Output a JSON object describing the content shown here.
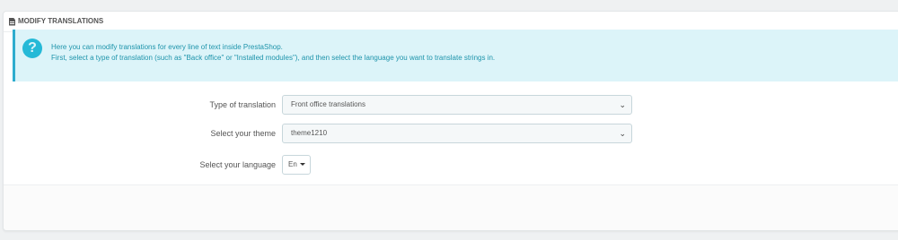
{
  "panel": {
    "title": "MODIFY TRANSLATIONS",
    "title_icon": "document-icon"
  },
  "alert": {
    "icon": "question-icon",
    "icon_glyph": "?",
    "line1": "Here you can modify translations for every line of text inside PrestaShop.",
    "line2": "First, select a type of translation (such as \"Back office\" or \"Installed modules\"), and then select the language you want to translate strings in."
  },
  "form": {
    "type_label": "Type of translation",
    "type_value": "Front office translations",
    "theme_label": "Select your theme",
    "theme_value": "theme1210",
    "language_label": "Select your language",
    "language_value": "En"
  },
  "colors": {
    "alert_bg": "#dcf4f9",
    "alert_text": "#1e94ab",
    "alert_icon": "#25b9d7"
  }
}
